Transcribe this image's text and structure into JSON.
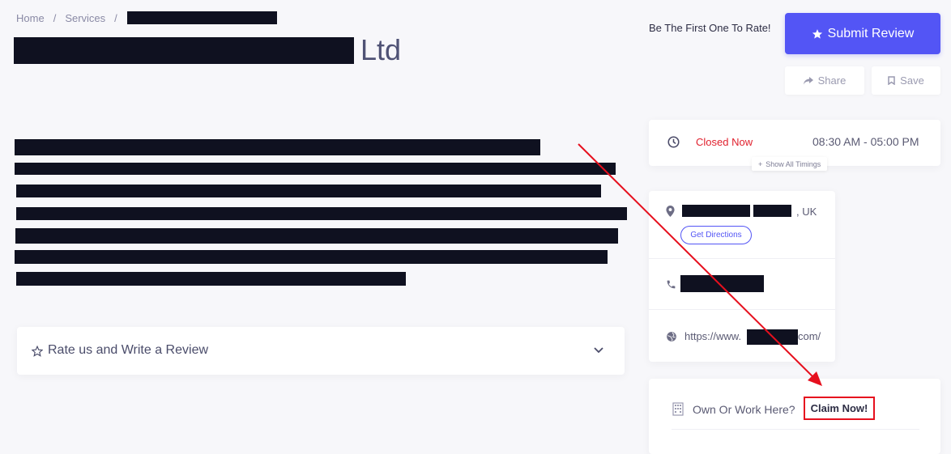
{
  "breadcrumb": {
    "home": "Home",
    "services": "Services",
    "separator": "/"
  },
  "title": {
    "suffix": "Ltd"
  },
  "header": {
    "first_rate_text": "Be The First One To Rate!",
    "submit_review_label": "Submit Review",
    "share_label": "Share",
    "save_label": "Save"
  },
  "timings": {
    "status": "Closed Now",
    "status_color": "#e0202d",
    "hours": "08:30 AM - 05:00 PM",
    "show_all_label": "Show All Timings"
  },
  "contact": {
    "address_suffix": ", UK",
    "directions_label": "Get Directions",
    "website_prefix": "https://www.",
    "website_suffix": "com/"
  },
  "claim": {
    "question": "Own Or Work Here?",
    "button_label": "Claim Now!"
  },
  "review": {
    "label": "Rate us and Write a Review"
  },
  "colors": {
    "accent": "#5355f5",
    "annotation": "#e6101e"
  }
}
